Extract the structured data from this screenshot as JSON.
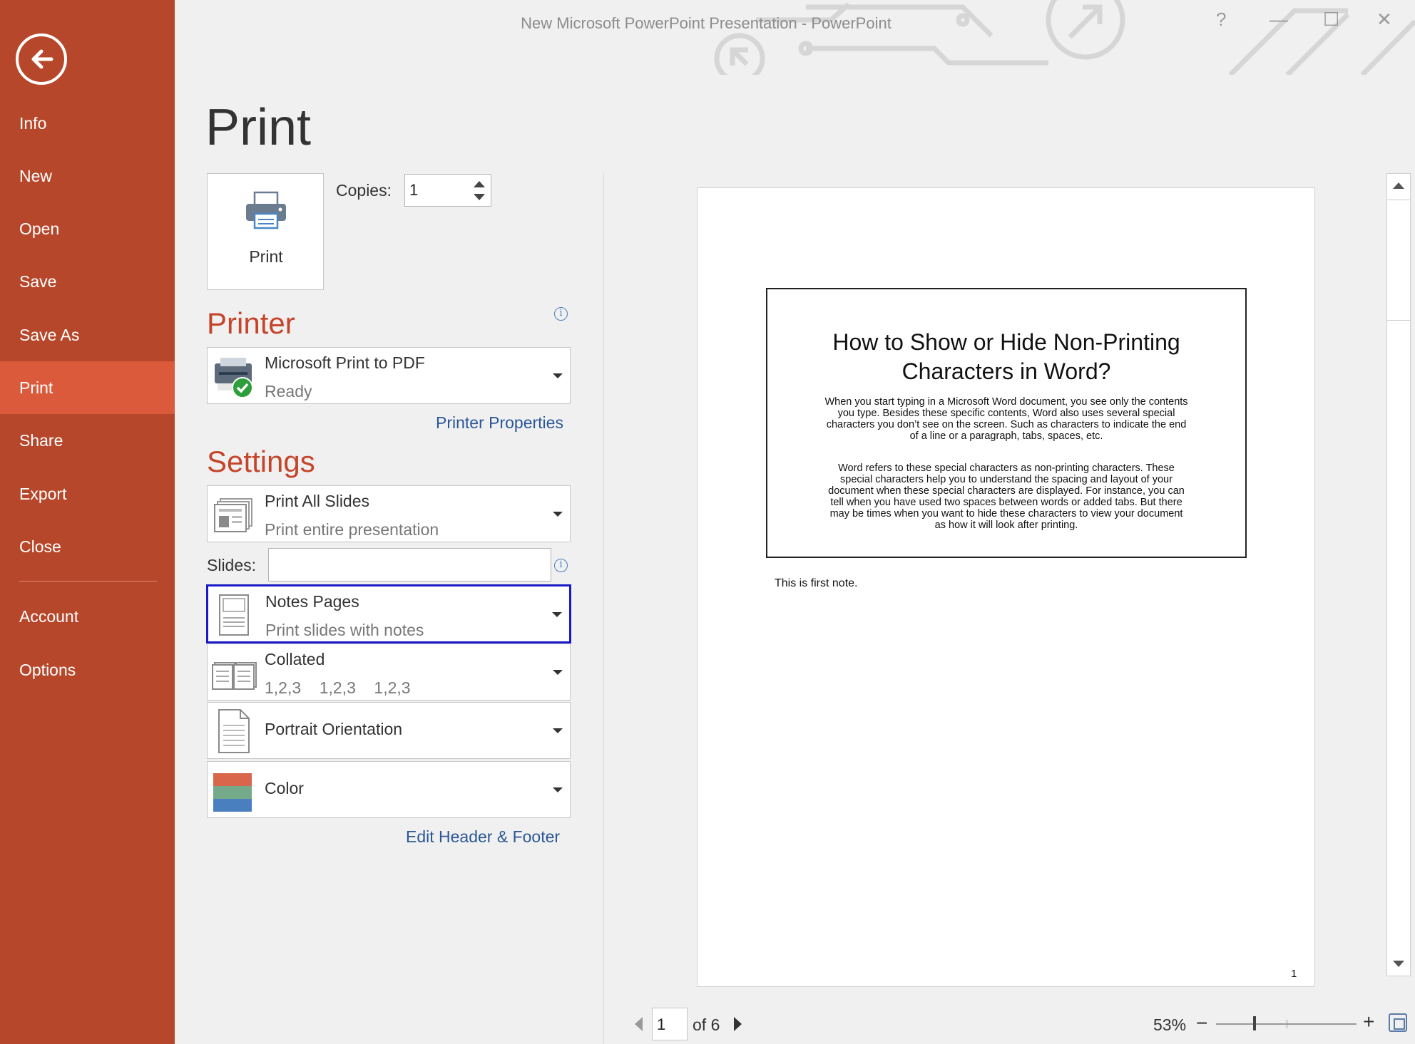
{
  "window": {
    "title": "New Microsoft PowerPoint Presentation - PowerPoint",
    "help": "?",
    "minimize": "—",
    "maximize": "☐",
    "close": "✕"
  },
  "sidebar": {
    "items": [
      {
        "label": "Info"
      },
      {
        "label": "New"
      },
      {
        "label": "Open"
      },
      {
        "label": "Save"
      },
      {
        "label": "Save As"
      },
      {
        "label": "Print",
        "active": true
      },
      {
        "label": "Share"
      },
      {
        "label": "Export"
      },
      {
        "label": "Close"
      },
      {
        "label": "Account"
      },
      {
        "label": "Options"
      }
    ]
  },
  "page_title": "Print",
  "print_button": {
    "label": "Print"
  },
  "copies": {
    "label": "Copies:",
    "value": "1"
  },
  "printer": {
    "heading": "Printer",
    "name": "Microsoft Print to PDF",
    "status": "Ready",
    "properties_link": "Printer Properties"
  },
  "settings": {
    "heading": "Settings",
    "range": {
      "title": "Print All Slides",
      "subtitle": "Print entire presentation"
    },
    "slides_label": "Slides:",
    "slides_value": "",
    "layout": {
      "title": "Notes Pages",
      "subtitle": "Print slides with notes"
    },
    "collation": {
      "title": "Collated",
      "subtitle": "1,2,3    1,2,3    1,2,3"
    },
    "orientation": {
      "title": "Portrait Orientation"
    },
    "color": {
      "title": "Color"
    },
    "header_footer_link": "Edit Header & Footer"
  },
  "preview": {
    "slide_title": "How to Show or Hide Non-Printing Characters in Word?",
    "slide_para1": "When you start typing in a Microsoft Word document, you see only the contents you type. Besides these specific contents, Word also uses several special characters you don’t see on the screen. Such as characters to indicate the end of a line or a paragraph, tabs, spaces, etc.",
    "slide_para2": "Word refers to these special characters as non-printing characters. These special characters help you to understand the spacing and layout of your document when these special characters are displayed. For instance, you can tell when you have used two spaces between words or added tabs. But there may be times when you want to hide these characters to view your document as how it will look after printing.",
    "note": "This is first note.",
    "page_number": "1"
  },
  "pager": {
    "current": "1",
    "of_text": "of 6"
  },
  "zoom": {
    "percent": "53%",
    "minus": "−",
    "plus": "+"
  },
  "colors": {
    "sidebar": "#b7472a",
    "sidebar_active": "#dc5a3c",
    "heading": "#c5452b",
    "link": "#2b5797",
    "highlight": "#1a1ac8"
  }
}
